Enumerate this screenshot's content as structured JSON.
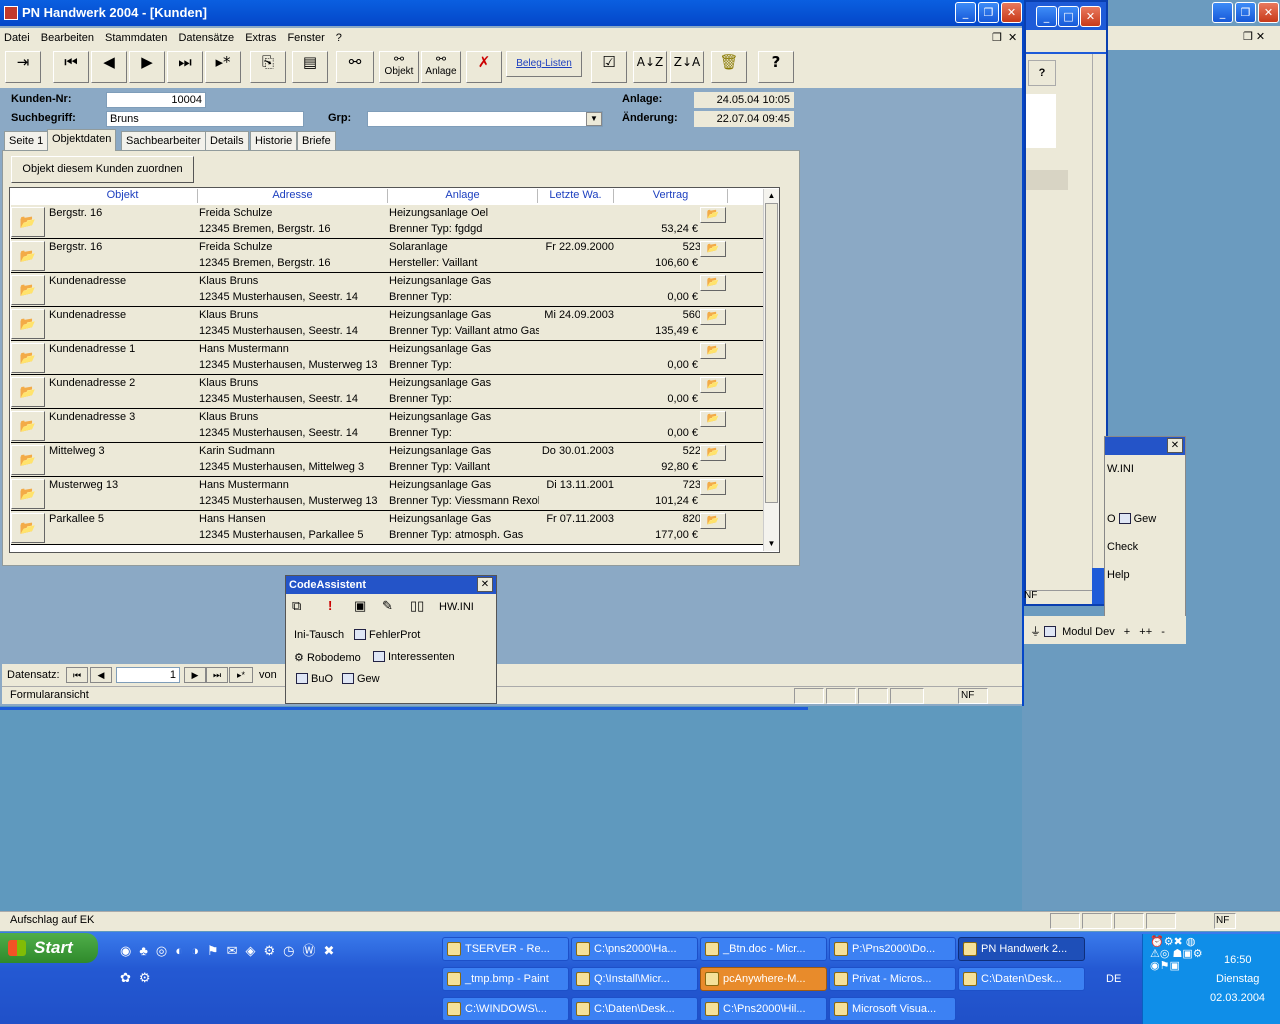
{
  "main_window": {
    "title": "PN Handwerk 2004 - [Kunden]",
    "menu": [
      "Datei",
      "Bearbeiten",
      "Stammdaten",
      "Datensätze",
      "Extras",
      "Fenster",
      "?"
    ],
    "toolbar": {
      "objekt_label": "Objekt",
      "anlage_label": "Anlage",
      "beleg_listen_label": "Beleg-Listen"
    }
  },
  "form": {
    "kunden_nr_label": "Kunden-Nr:",
    "kunden_nr": "10004",
    "suchbegriff_label": "Suchbegriff:",
    "suchbegriff": "Bruns",
    "grp_label": "Grp:",
    "grp": "",
    "anlage_label": "Anlage:",
    "anlage": "24.05.04 10:05",
    "aenderung_label": "Änderung:",
    "aenderung": "22.07.04 09:45",
    "tabs": [
      "Seite 1",
      "Objektdaten",
      "Sachbearbeiter",
      "Details",
      "Historie",
      "Briefe"
    ],
    "assign_button": "Objekt diesem Kunden zuordnen",
    "columns": [
      "Objekt",
      "Adresse",
      "Anlage",
      "Letzte Wa.",
      "Vertrag"
    ],
    "rows": [
      {
        "objekt": "Bergstr. 16",
        "name": "Freida Schulze",
        "addr": "12345 Bremen, Bergstr. 16",
        "anlage": "Heizungsanlage Oel",
        "typ": "Brenner Typ: fgdgd",
        "wartung": "",
        "vertrag": "",
        "betrag": "53,24 €"
      },
      {
        "objekt": "Bergstr. 16",
        "name": "Freida Schulze",
        "addr": "12345 Bremen, Bergstr. 16",
        "anlage": "Solaranlage",
        "typ": "Hersteller: Vaillant",
        "wartung": "Fr 22.09.2000",
        "vertrag": "523",
        "betrag": "106,60 €"
      },
      {
        "objekt": "Kundenadresse",
        "name": "Klaus Bruns",
        "addr": "12345 Musterhausen, Seestr. 14",
        "anlage": "Heizungsanlage Gas",
        "typ": "Brenner Typ:",
        "wartung": "",
        "vertrag": "",
        "betrag": "0,00 €"
      },
      {
        "objekt": "Kundenadresse",
        "name": "Klaus Bruns",
        "addr": "12345 Musterhausen, Seestr. 14",
        "anlage": "Heizungsanlage Gas",
        "typ": "Brenner Typ: Vaillant  atmo Gas",
        "wartung": "Mi 24.09.2003",
        "vertrag": "560",
        "betrag": "135,49 €"
      },
      {
        "objekt": "Kundenadresse 1",
        "name": "Hans Mustermann",
        "addr": "12345 Musterhausen, Musterweg 13",
        "anlage": "Heizungsanlage Gas",
        "typ": "Brenner Typ:",
        "wartung": "",
        "vertrag": "",
        "betrag": "0,00 €"
      },
      {
        "objekt": "Kundenadresse 2",
        "name": "Klaus Bruns",
        "addr": "12345 Musterhausen, Seestr. 14",
        "anlage": "Heizungsanlage Gas",
        "typ": "Brenner Typ:",
        "wartung": "",
        "vertrag": "",
        "betrag": "0,00 €"
      },
      {
        "objekt": "Kundenadresse 3",
        "name": "Klaus Bruns",
        "addr": "12345 Musterhausen, Seestr. 14",
        "anlage": "Heizungsanlage Gas",
        "typ": "Brenner Typ:",
        "wartung": "",
        "vertrag": "",
        "betrag": "0,00 €"
      },
      {
        "objekt": "Mittelweg 3",
        "name": "Karin Sudmann",
        "addr": "12345 Musterhausen, Mittelweg 3",
        "anlage": "Heizungsanlage Gas",
        "typ": "Brenner Typ: Vaillant",
        "wartung": "Do 30.01.2003",
        "vertrag": "522",
        "betrag": "92,80 €"
      },
      {
        "objekt": "Musterweg 13",
        "name": "Hans Mustermann",
        "addr": "12345 Musterhausen, Musterweg 13",
        "anlage": "Heizungsanlage Gas",
        "typ": "Brenner Typ: Viessmann Rexola",
        "wartung": "Di 13.11.2001",
        "vertrag": "723",
        "betrag": "101,24 €"
      },
      {
        "objekt": "Parkallee 5",
        "name": "Hans Hansen",
        "addr": "12345 Musterhausen, Parkallee 5",
        "anlage": "Heizungsanlage Gas",
        "typ": "Brenner Typ: atmosph. Gas",
        "wartung": "Fr 07.11.2003",
        "vertrag": "820",
        "betrag": "177,00 €"
      }
    ],
    "datensatz_label": "Datensatz:",
    "datensatz_value": "1",
    "von_label": "von",
    "status_left": "Formularansicht",
    "status_nf": "NF"
  },
  "code_assistent": {
    "title": "CodeAssistent",
    "hw_ini": "HW.INI",
    "items": [
      "Ini-Tausch",
      "FehlerProt",
      "Robodemo",
      "Interessenten",
      "BuO",
      "Gew"
    ]
  },
  "right_fragments": {
    "hw_ini": "W.INI",
    "gew": "Gew",
    "o": "O",
    "check": "Check",
    "help": "Help",
    "modul_dev": "Modul Dev",
    "plus": "+",
    "plusplus": "++",
    "minus": "-",
    "nf": "NF"
  },
  "bottom_status": {
    "text": "Aufschlag auf EK",
    "nf": "NF"
  },
  "taskbar": {
    "start": "Start",
    "tasks": [
      {
        "label": "TSERVER - Re..."
      },
      {
        "label": "C:\\pns2000\\Ha..."
      },
      {
        "label": "_Btn.doc - Micr..."
      },
      {
        "label": "P:\\Pns2000\\Do..."
      },
      {
        "label": "PN Handwerk 2..."
      },
      {
        "label": "_tmp.bmp - Paint"
      },
      {
        "label": "Q:\\Install\\Micr..."
      },
      {
        "label": "pcAnywhere-M..."
      },
      {
        "label": "Privat - Micros..."
      },
      {
        "label": "C:\\Daten\\Desk..."
      },
      {
        "label": "C:\\WINDOWS\\..."
      },
      {
        "label": "C:\\Daten\\Desk..."
      },
      {
        "label": "C:\\Pns2000\\Hil..."
      },
      {
        "label": "Microsoft Visua..."
      }
    ],
    "lang": "DE",
    "time": "16:50",
    "day": "Dienstag",
    "date": "02.03.2004"
  }
}
